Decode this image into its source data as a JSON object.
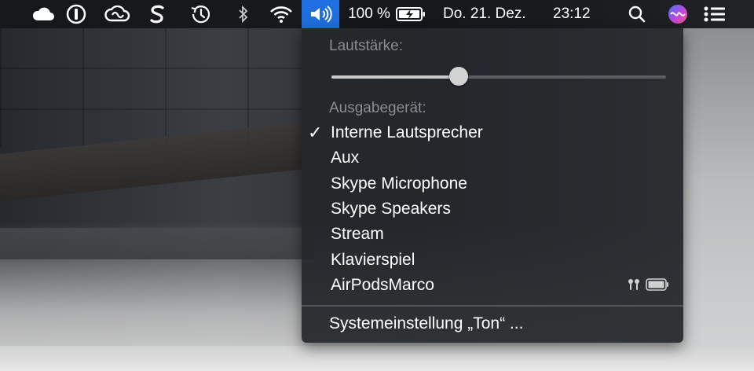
{
  "menubar": {
    "icons": [
      "icloud-icon",
      "onepassword-icon",
      "creative-cloud-icon",
      "scrivener-icon",
      "time-machine-icon",
      "bluetooth-icon",
      "wifi-icon",
      "volume-icon",
      "battery-icon",
      "search-icon",
      "siri-icon",
      "notification-center-icon"
    ],
    "battery_label": "100 %",
    "date": "Do. 21. Dez.",
    "time": "23:12",
    "accent_color": "#1f6fe0"
  },
  "volume_menu": {
    "volume_label": "Lautstärke:",
    "volume_level": 0.38,
    "output_label": "Ausgabegerät:",
    "devices": [
      {
        "name": "Interne Lautsprecher",
        "selected": true
      },
      {
        "name": "Aux",
        "selected": false
      },
      {
        "name": "Skype Microphone",
        "selected": false
      },
      {
        "name": "Skype Speakers",
        "selected": false
      },
      {
        "name": "Stream",
        "selected": false
      },
      {
        "name": "Klavierspiel",
        "selected": false
      },
      {
        "name": "AirPodsMarco",
        "selected": false,
        "extra_icons": [
          "airpods-icon",
          "battery-full-icon"
        ]
      }
    ],
    "checkmark": "✓",
    "preferences_label": "Systemeinstellung „Ton“ ..."
  }
}
